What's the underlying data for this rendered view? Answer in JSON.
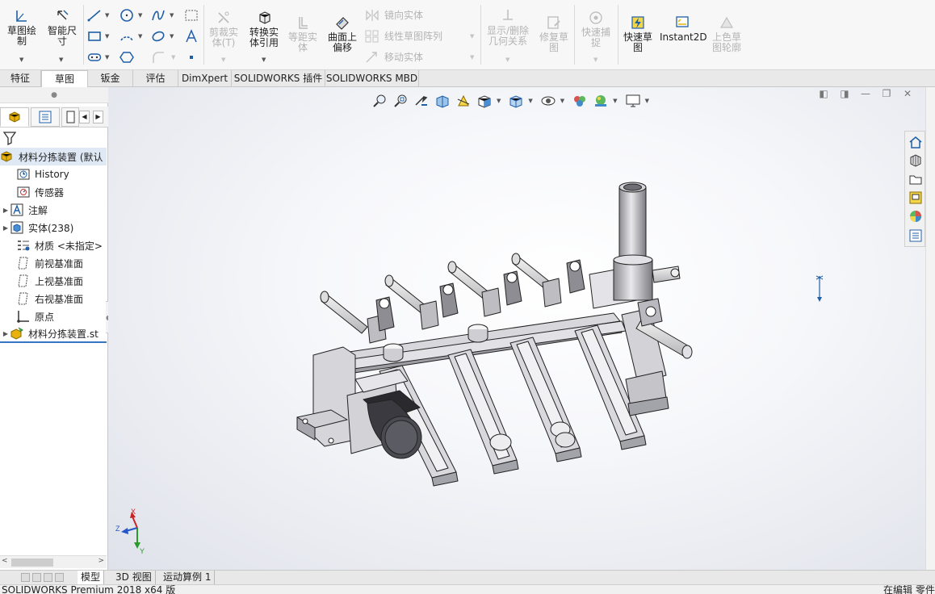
{
  "ribbon": {
    "sketch_label_line1": "草图绘",
    "sketch_label_line2": "制",
    "smart_dim_line1": "智能尺",
    "smart_dim_line2": "寸",
    "trim_line1": "剪裁实",
    "trim_line2": "体(T)",
    "convert_line1": "转换实",
    "convert_line2": "体引用",
    "offset_line1": "等距实",
    "offset_line2": "体",
    "surface_offset_line1": "曲面上",
    "surface_offset_line2": "偏移",
    "mirror": "镜向实体",
    "linear_pattern": "线性草图阵列",
    "move": "移动实体",
    "show_relations_line1": "显示/删除",
    "show_relations_line2": "几何关系",
    "repair_line1": "修复草",
    "repair_line2": "图",
    "quick_snap_line1": "快速捕",
    "quick_snap_line2": "捉",
    "rapid_sketch_line1": "快速草",
    "rapid_sketch_line2": "图",
    "instant2d": "Instant2D",
    "shaded_line1": "上色草",
    "shaded_line2": "图轮廓"
  },
  "tabs": [
    {
      "label": "特征"
    },
    {
      "label": "草图"
    },
    {
      "label": "钣金"
    },
    {
      "label": "评估"
    },
    {
      "label": "DimXpert"
    },
    {
      "label": "SOLIDWORKS 插件"
    },
    {
      "label": "SOLIDWORKS MBD"
    }
  ],
  "tree": {
    "root": "材料分拣装置 (默认",
    "items": [
      {
        "label": "History"
      },
      {
        "label": "传感器"
      },
      {
        "label": "注解"
      },
      {
        "label": "实体(238)"
      },
      {
        "label": "材质 <未指定>"
      },
      {
        "label": "前视基准面"
      },
      {
        "label": "上视基准面"
      },
      {
        "label": "右视基准面"
      },
      {
        "label": "原点"
      },
      {
        "label": "材料分拣装置.st"
      }
    ]
  },
  "triad": {
    "x": "X",
    "y": "Y",
    "z": "Z"
  },
  "bottom_tabs": [
    {
      "label": "模型"
    },
    {
      "label": "3D 视图"
    },
    {
      "label": "运动算例 1"
    }
  ],
  "status": {
    "left": "SOLIDWORKS Premium 2018 x64 版",
    "right": "在编辑 零件"
  },
  "colors": {
    "accent": "#3875c6",
    "icon_blue": "#1f5fa8",
    "icon_yellow": "#e8b20d",
    "disabled": "#b4b4b4"
  }
}
